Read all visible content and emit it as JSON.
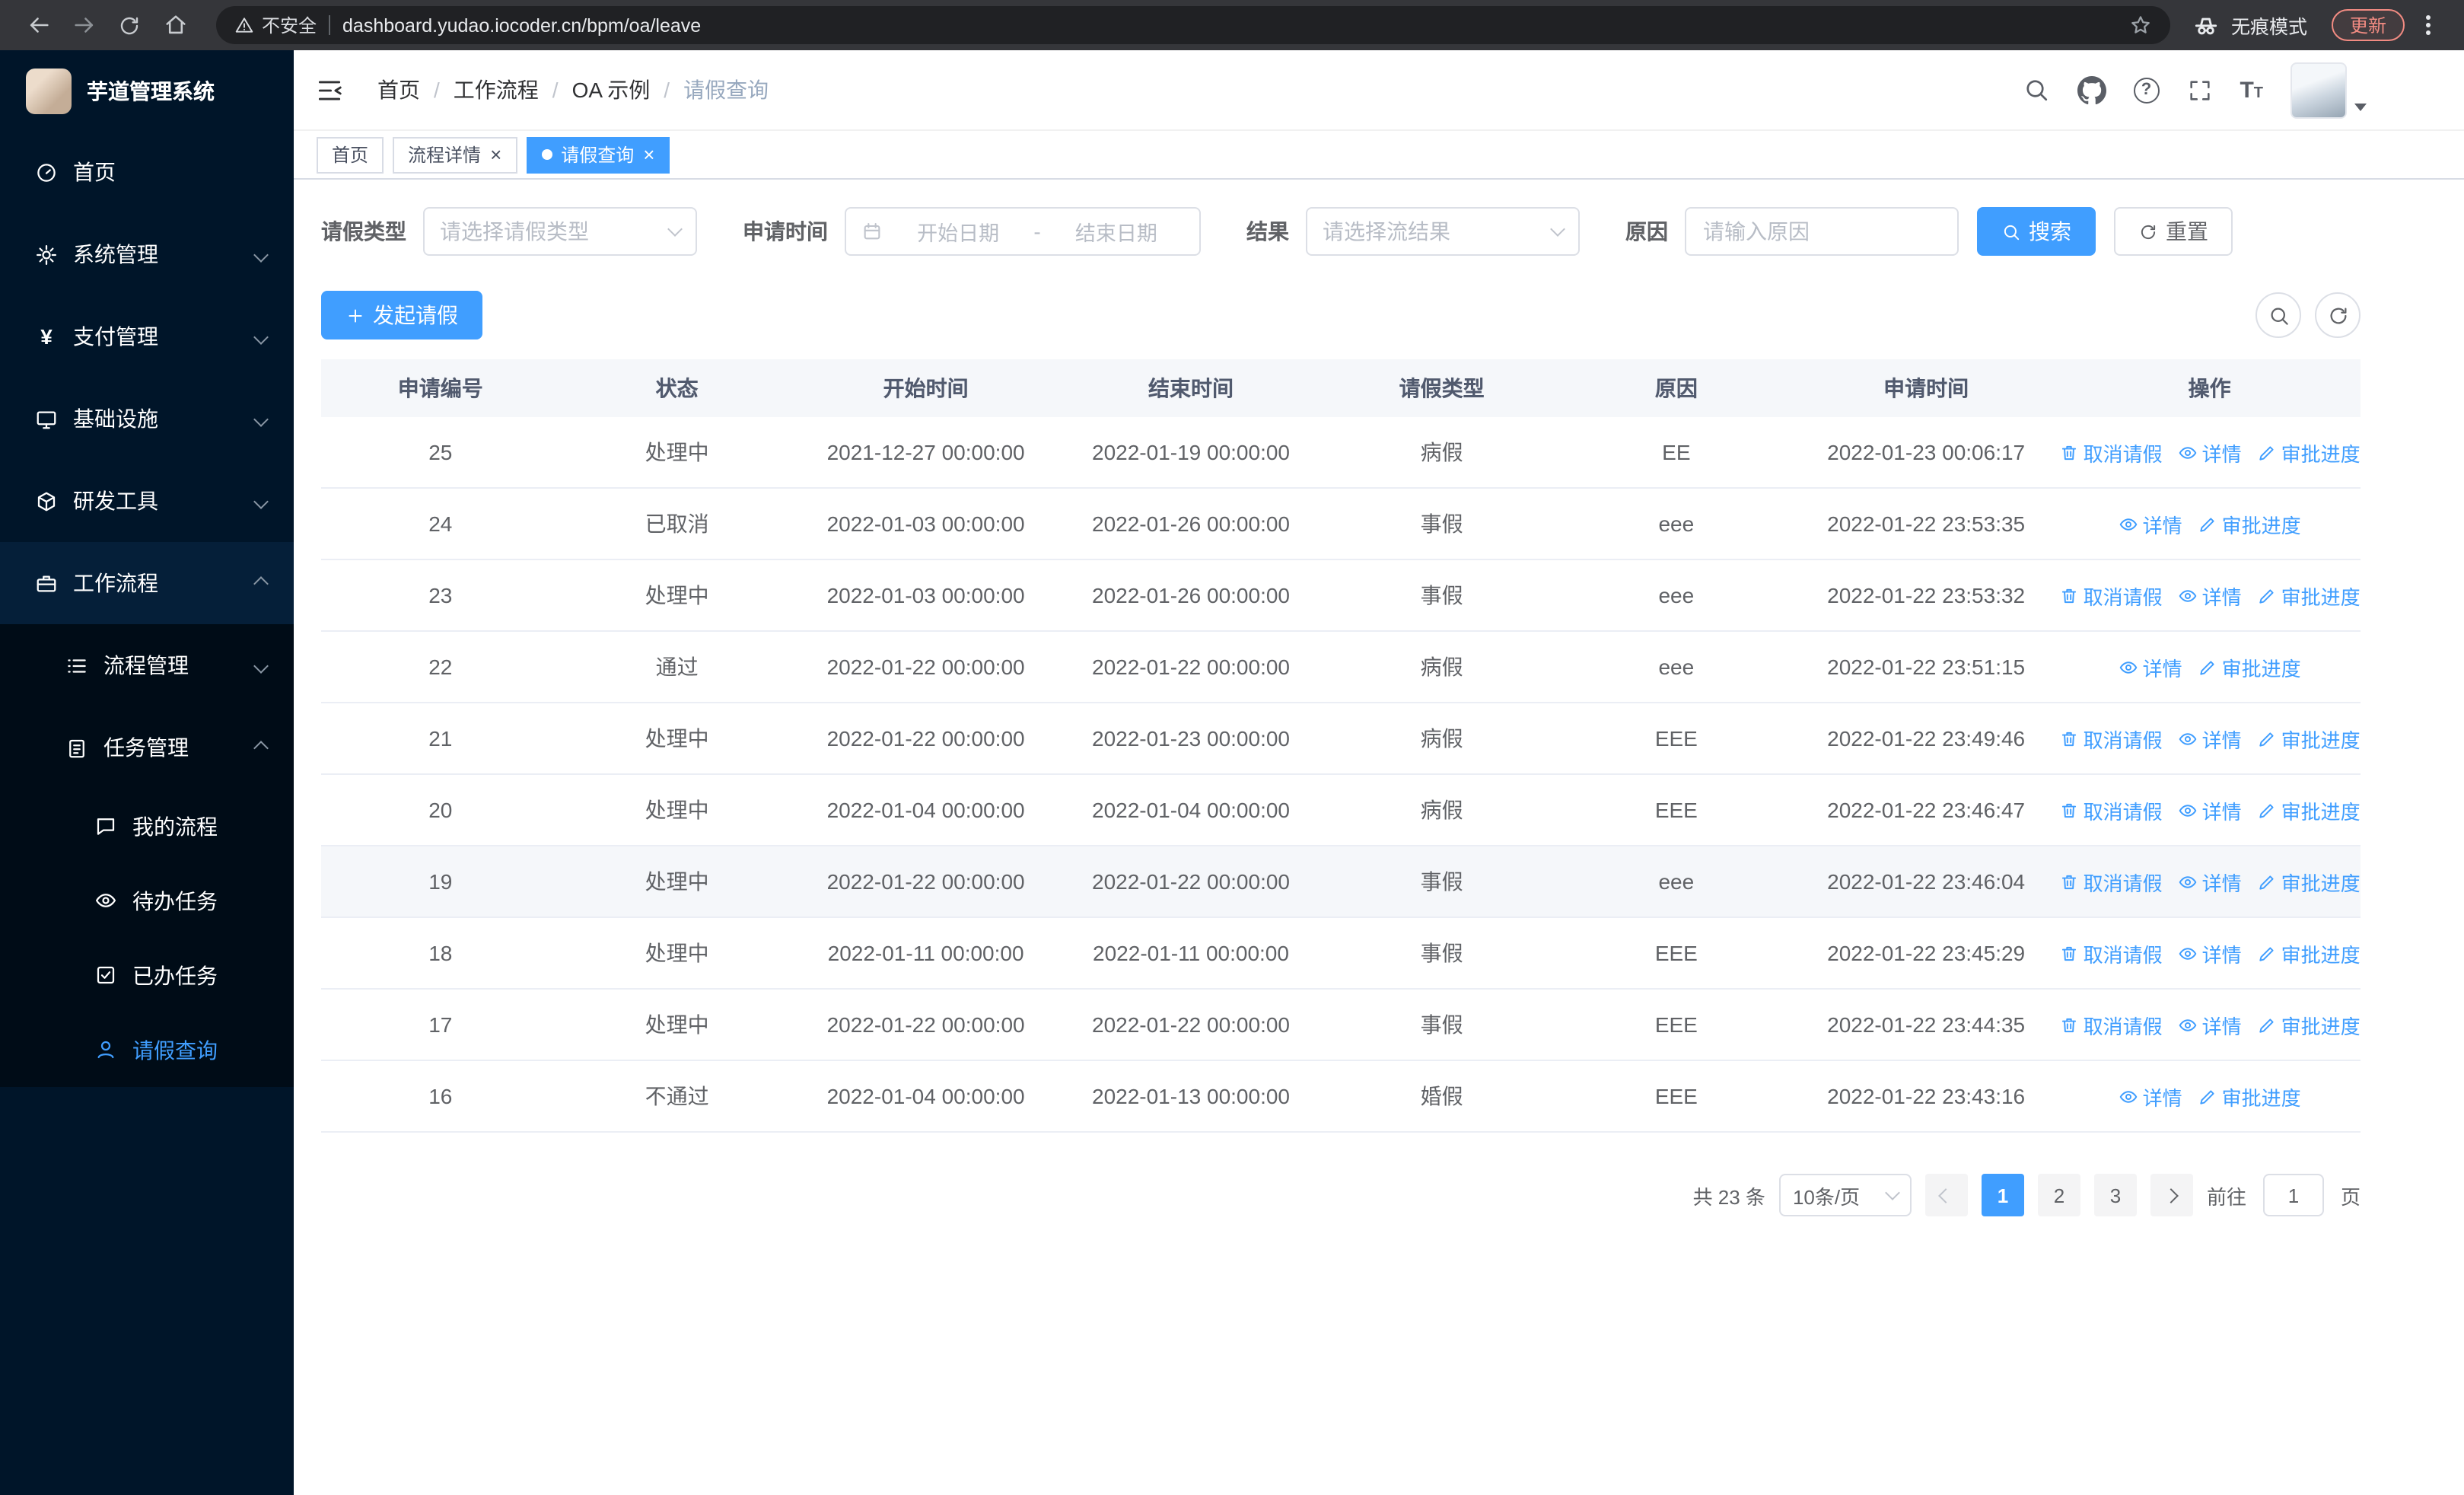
{
  "browser": {
    "security_label": "不安全",
    "url": "dashboard.yudao.iocoder.cn/bpm/oa/leave",
    "incognito_label": "无痕模式",
    "update_label": "更新"
  },
  "sidebar": {
    "title": "芋道管理系统",
    "items": [
      {
        "label": "首页"
      },
      {
        "label": "系统管理"
      },
      {
        "label": "支付管理"
      },
      {
        "label": "基础设施"
      },
      {
        "label": "研发工具"
      },
      {
        "label": "工作流程"
      }
    ],
    "submenu": [
      {
        "label": "流程管理"
      },
      {
        "label": "任务管理"
      }
    ],
    "task_items": [
      {
        "label": "我的流程"
      },
      {
        "label": "待办任务"
      },
      {
        "label": "已办任务"
      },
      {
        "label": "请假查询"
      }
    ]
  },
  "header": {
    "breadcrumb": [
      "首页",
      "工作流程",
      "OA 示例",
      "请假查询"
    ]
  },
  "tabs": [
    {
      "label": "首页"
    },
    {
      "label": "流程详情"
    },
    {
      "label": "请假查询"
    }
  ],
  "filters": {
    "type_label": "请假类型",
    "type_placeholder": "请选择请假类型",
    "time_label": "申请时间",
    "start_placeholder": "开始日期",
    "range_separator": "-",
    "end_placeholder": "结束日期",
    "result_label": "结果",
    "result_placeholder": "请选择流结果",
    "reason_label": "原因",
    "reason_placeholder": "请输入原因",
    "search_button": "搜索",
    "reset_button": "重置"
  },
  "toolbar": {
    "create_button": "发起请假"
  },
  "table": {
    "columns": [
      "申请编号",
      "状态",
      "开始时间",
      "结束时间",
      "请假类型",
      "原因",
      "申请时间",
      "操作"
    ],
    "actions": {
      "cancel": "取消请假",
      "detail": "详情",
      "progress": "审批进度"
    },
    "rows": [
      {
        "id": "25",
        "status": "处理中",
        "start": "2021-12-27 00:00:00",
        "end": "2022-01-19 00:00:00",
        "type": "病假",
        "reason": "EE",
        "applied": "2022-01-23 00:06:17",
        "cancel": true
      },
      {
        "id": "24",
        "status": "已取消",
        "start": "2022-01-03 00:00:00",
        "end": "2022-01-26 00:00:00",
        "type": "事假",
        "reason": "eee",
        "applied": "2022-01-22 23:53:35",
        "cancel": false
      },
      {
        "id": "23",
        "status": "处理中",
        "start": "2022-01-03 00:00:00",
        "end": "2022-01-26 00:00:00",
        "type": "事假",
        "reason": "eee",
        "applied": "2022-01-22 23:53:32",
        "cancel": true
      },
      {
        "id": "22",
        "status": "通过",
        "start": "2022-01-22 00:00:00",
        "end": "2022-01-22 00:00:00",
        "type": "病假",
        "reason": "eee",
        "applied": "2022-01-22 23:51:15",
        "cancel": false
      },
      {
        "id": "21",
        "status": "处理中",
        "start": "2022-01-22 00:00:00",
        "end": "2022-01-23 00:00:00",
        "type": "病假",
        "reason": "EEE",
        "applied": "2022-01-22 23:49:46",
        "cancel": true
      },
      {
        "id": "20",
        "status": "处理中",
        "start": "2022-01-04 00:00:00",
        "end": "2022-01-04 00:00:00",
        "type": "病假",
        "reason": "EEE",
        "applied": "2022-01-22 23:46:47",
        "cancel": true
      },
      {
        "id": "19",
        "status": "处理中",
        "start": "2022-01-22 00:00:00",
        "end": "2022-01-22 00:00:00",
        "type": "事假",
        "reason": "eee",
        "applied": "2022-01-22 23:46:04",
        "cancel": true,
        "rowClass": "hl"
      },
      {
        "id": "18",
        "status": "处理中",
        "start": "2022-01-11 00:00:00",
        "end": "2022-01-11 00:00:00",
        "type": "事假",
        "reason": "EEE",
        "applied": "2022-01-22 23:45:29",
        "cancel": true
      },
      {
        "id": "17",
        "status": "处理中",
        "start": "2022-01-22 00:00:00",
        "end": "2022-01-22 00:00:00",
        "type": "事假",
        "reason": "EEE",
        "applied": "2022-01-22 23:44:35",
        "cancel": true
      },
      {
        "id": "16",
        "status": "不通过",
        "start": "2022-01-04 00:00:00",
        "end": "2022-01-13 00:00:00",
        "type": "婚假",
        "reason": "EEE",
        "applied": "2022-01-22 23:43:16",
        "cancel": false
      }
    ]
  },
  "pagination": {
    "total": "共 23 条",
    "page_size": "10条/页",
    "pages": [
      "1",
      "2",
      "3"
    ],
    "active_page": "1",
    "goto_label": "前往",
    "goto_value": "1",
    "page_unit": "页"
  },
  "colors": {
    "primary": "#409eff",
    "sidebar_bg": "#001529",
    "submenu_bg": "#000c17"
  }
}
